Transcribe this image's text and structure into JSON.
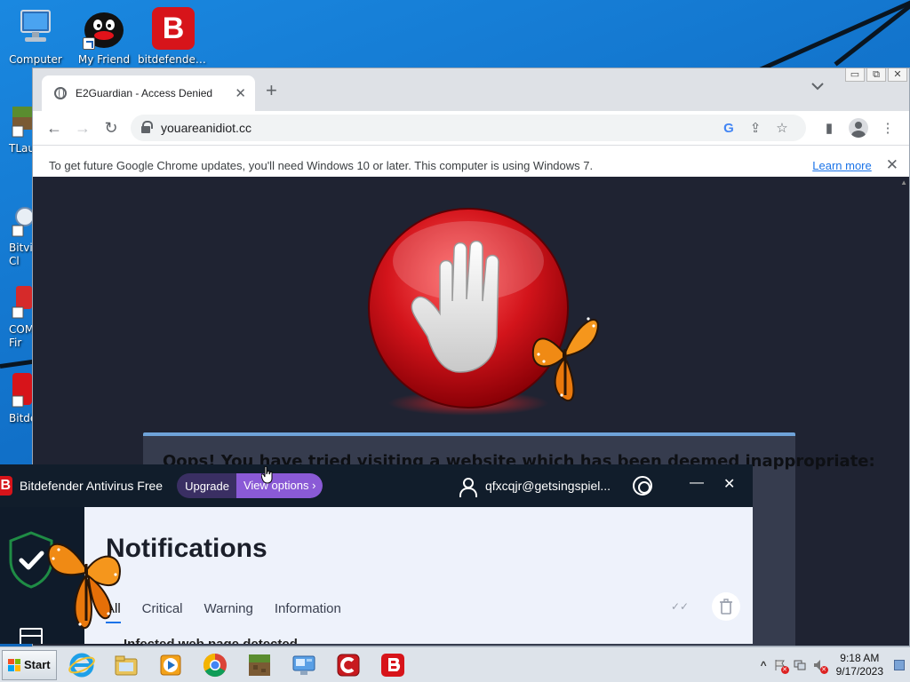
{
  "desktop": {
    "icons": [
      {
        "label": "Computer"
      },
      {
        "label": "My Friend"
      },
      {
        "label": "bitdefender..."
      }
    ],
    "left_partial_icons": [
      {
        "label": "TLau"
      },
      {
        "label": "Bitvi\nCl"
      },
      {
        "label": "COM\nFir"
      },
      {
        "label": "Bitde"
      }
    ]
  },
  "browser": {
    "tab": {
      "title": "E2Guardian - Access Denied",
      "close_glyph": "✕"
    },
    "new_tab_glyph": "+",
    "tab_search_glyph": "⌄",
    "window_controls": {
      "minimize": "▭",
      "restore": "⧉",
      "close": "✕"
    },
    "toolbar": {
      "back_glyph": "←",
      "forward_glyph": "→",
      "reload_glyph": "↻",
      "url": "youareanidiot.cc",
      "google_glyph": "G",
      "share_glyph": "⇪",
      "bookmark_glyph": "☆",
      "sidepanel_glyph": "▮",
      "menu_glyph": "⋮"
    },
    "infobar": {
      "message": "To get future Google Chrome updates, you'll need Windows 10 or later. This computer is using Windows 7.",
      "link": "Learn more",
      "close_glyph": "✕"
    },
    "page": {
      "blocked_message": "Oops! You have tried visiting a website which has been deemed inappropriate:",
      "scroll_glyph": "▲",
      "colors": {
        "background": "#1f2332",
        "card": "#363c4e",
        "card_accent": "#6fa3d9",
        "stop_red": "#d3141b"
      }
    }
  },
  "bitdefender": {
    "app_name": "Bitdefender Antivirus Free",
    "logo_letter": "B",
    "upgrade_label": "Upgrade",
    "view_options_label": "View options",
    "view_options_chevron": "›",
    "account_email": "qfxcqjr@getsingspiel...",
    "minimize_glyph": "—",
    "close_glyph": "✕",
    "heading": "Notifications",
    "tabs": [
      {
        "label": "All",
        "active": true
      },
      {
        "label": "Critical",
        "active": false
      },
      {
        "label": "Warning",
        "active": false
      },
      {
        "label": "Information",
        "active": false
      }
    ],
    "mark_read_glyph": "✓✓",
    "delete_glyph": "🗑",
    "notification_row": "Infected web page detected",
    "colors": {
      "accent": "#8a5ad6",
      "sidebar": "#0f1b2a",
      "brand_red": "#d7141a",
      "shield_green": "#1f6e3a"
    }
  },
  "taskbar": {
    "start_label": "Start",
    "apps": [
      {
        "icon": "internet-explorer-icon"
      },
      {
        "icon": "file-explorer-icon"
      },
      {
        "icon": "media-player-icon"
      },
      {
        "icon": "chrome-icon"
      },
      {
        "icon": "minecraft-icon"
      },
      {
        "icon": "remote-desktop-icon"
      },
      {
        "icon": "comodo-firewall-icon"
      },
      {
        "icon": "bitdefender-icon"
      }
    ],
    "tray": {
      "expand_glyph": "^",
      "time": "9:18 AM",
      "date": "9/17/2023"
    }
  }
}
